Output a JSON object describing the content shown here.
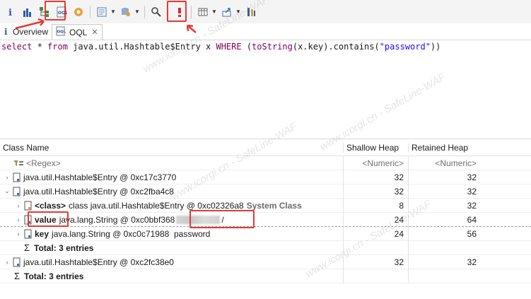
{
  "toolbar": {
    "items": [
      "info-icon",
      "histogram-icon",
      "dominator-tree-icon",
      "oql-icon",
      "heap-dump-overview-icon",
      "reports-icon",
      "query-browser-icon",
      "search-icon",
      "find-leaks-icon",
      "calculate-icon",
      "export-icon",
      "thread-icon"
    ]
  },
  "tabs": [
    {
      "label": "Overview",
      "icon": "info-icon"
    },
    {
      "label": "OQL",
      "icon": "oql-icon",
      "close": "✕"
    }
  ],
  "query": {
    "select_kw": "select",
    "star": " * ",
    "from_kw": "from",
    "class_part": " java.util.Hashtable$Entry x ",
    "where_kw": "WHERE",
    "open_paren": " (",
    "tostring_kw": "toString",
    "call_part": "(x.key).contains(",
    "string_literal": "\"password\"",
    "close_part": "))"
  },
  "table": {
    "headers": {
      "name": "Class Name",
      "shallow": "Shallow Heap",
      "retained": "Retained Heap"
    },
    "filter": {
      "name": "<Regex>",
      "shallow": "<Numeric>",
      "retained": "<Numeric>"
    },
    "rows": [
      {
        "name": "java.util.Hashtable$Entry @ 0xc17c3770",
        "shallow": "32",
        "retained": "32"
      },
      {
        "name": "java.util.Hashtable$Entry @ 0xc2fba4c8",
        "shallow": "32",
        "retained": "32"
      },
      {
        "label": "<class>",
        "name": "class java.util.Hashtable$Entry @ 0xc02326a8",
        "suffix": "System Class",
        "shallow": "8",
        "retained": "32"
      },
      {
        "label": "value",
        "name": "java.lang.String @ 0xc0bbf368",
        "suffix": "/",
        "shallow": "24",
        "retained": "64"
      },
      {
        "label": "key",
        "name": "java.lang.String @ 0xc0c71988  password",
        "shallow": "24",
        "retained": "56"
      },
      {
        "label": "Total: 3 entries"
      },
      {
        "name": "java.util.Hashtable$Entry @ 0xc2fc38e0",
        "shallow": "32",
        "retained": "32"
      },
      {
        "label": "Total: 3 entries"
      }
    ]
  },
  "watermark_text": "www.icorgi.cn - SafeLine-WAF",
  "colors": {
    "highlight": "#e53935",
    "keyword": "#7f0055",
    "string": "#2a00ff"
  }
}
